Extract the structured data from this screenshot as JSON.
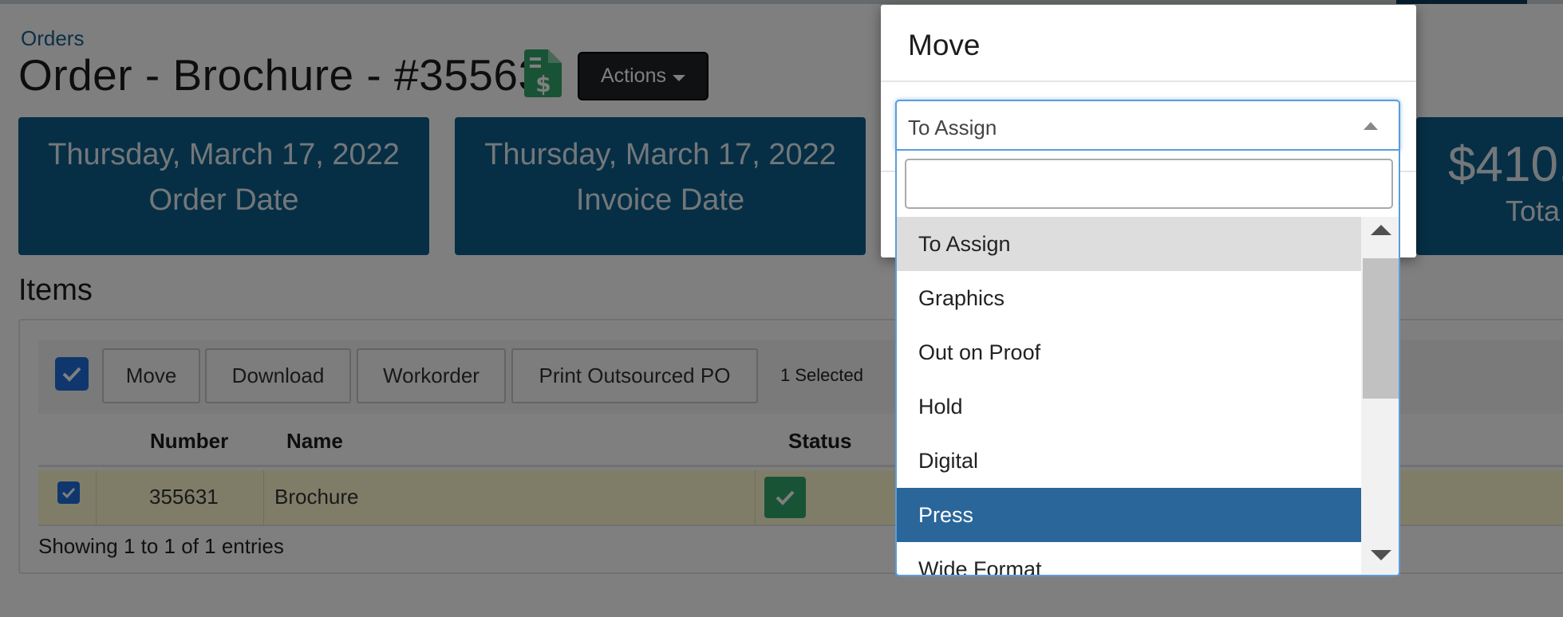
{
  "breadcrumb": "Orders",
  "page_title": "Order - Brochure - #35563",
  "header": {
    "actions_label": "Actions"
  },
  "cards": [
    {
      "value": "Thursday, March 17, 2022",
      "label": "Order Date"
    },
    {
      "value": "Thursday, March 17, 2022",
      "label": "Invoice Date"
    },
    {
      "value": "$410.",
      "label": "Tota"
    }
  ],
  "items": {
    "title": "Items",
    "toolbar": {
      "move_label": "Move",
      "download_label": "Download",
      "workorder_label": "Workorder",
      "print_label": "Print Outsourced PO",
      "selected_text": "1 Selected"
    },
    "columns": {
      "number": "Number",
      "name": "Name",
      "status": "Status"
    },
    "rows": [
      {
        "number": "355631",
        "name": "Brochure",
        "status": "complete",
        "checked": true
      }
    ],
    "entries_text": "Showing 1 to 1 of 1 entries"
  },
  "modal": {
    "title": "Move",
    "select": {
      "value": "To Assign",
      "search_value": "",
      "options": [
        "To Assign",
        "Graphics",
        "Out on Proof",
        "Hold",
        "Digital",
        "Press",
        "Wide Format"
      ],
      "highlighted": "To Assign",
      "selected_hover": "Press"
    }
  },
  "colors": {
    "card_bg": "#0d5f8b",
    "accent_blue": "#1e6fdc",
    "status_green": "#33a66a",
    "option_selected": "#2a6699",
    "doc_icon_green": "#33a66a"
  },
  "icons": {
    "doc": "invoice-dollar-icon",
    "caret": "caret-down-icon",
    "check": "checkmark-icon"
  }
}
